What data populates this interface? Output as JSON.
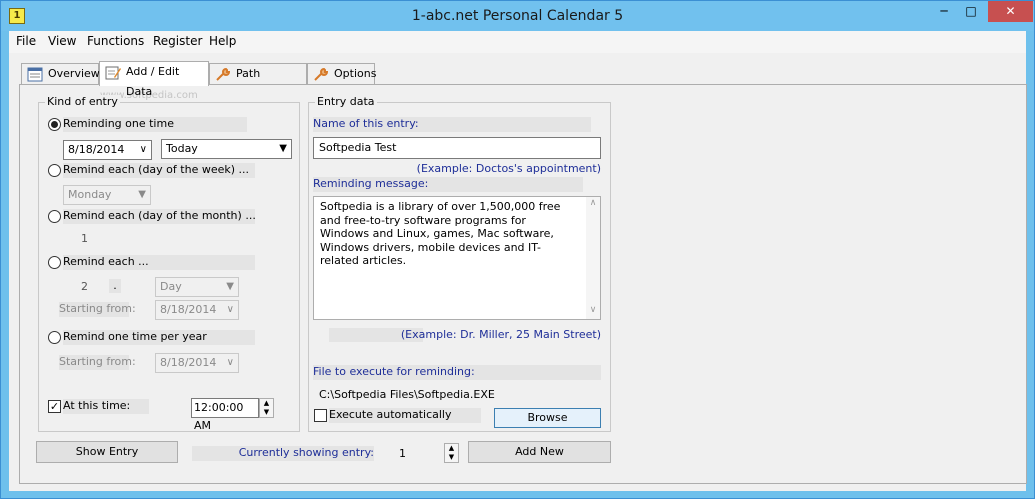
{
  "window": {
    "title": "1-abc.net Personal Calendar 5"
  },
  "menu": [
    "File",
    "View",
    "Functions",
    "Register",
    "Help"
  ],
  "tabs": [
    {
      "label": "Overview",
      "icon": "calendar-icon"
    },
    {
      "label": "Add / Edit Data",
      "icon": "edit-icon"
    },
    {
      "label": "Path Settings",
      "icon": "wrench-icon"
    },
    {
      "label": "Options",
      "icon": "wrench-icon"
    }
  ],
  "kind": {
    "title": "Kind of entry",
    "once": {
      "label": "Reminding one time",
      "date": "8/18/2014",
      "when": "Today"
    },
    "week": {
      "label": "Remind each (day of the week) ...",
      "day": "Monday"
    },
    "month": {
      "label": "Remind each (day of the month) ...",
      "day": "1"
    },
    "each": {
      "label": "Remind each ...",
      "count": "2",
      "sep": ".",
      "unit": "Day",
      "start_label": "Starting from:",
      "start": "8/18/2014"
    },
    "year": {
      "label": "Remind one time per year",
      "start_label": "Starting from:",
      "start": "8/18/2014"
    },
    "time": {
      "label": "At this time:",
      "value": "12:00:00 AM"
    }
  },
  "entry": {
    "title": "Entry data",
    "name_label": "Name of this entry:",
    "name_value": "Softpedia Test",
    "name_example": "(Example: Doctos's appointment)",
    "msg_label": "Reminding message:",
    "msg_value": "Softpedia is a library of over 1,500,000 free and free-to-try software programs for Windows and Linux, games, Mac software, Windows drivers, mobile devices and IT-related articles.",
    "msg_example": "(Example: Dr. Miller, 25 Main Street)",
    "file_label": "File to execute for reminding:",
    "file_value": "C:\\Softpedia Files\\Softpedia.EXE",
    "exec_label": "Execute automatically",
    "browse": "Browse"
  },
  "footer": {
    "show_entry": "Show Entry",
    "current_label": "Currently showing entry:",
    "current_value": "1",
    "add_new": "Add New"
  },
  "watermark": "www.softpedia.com"
}
